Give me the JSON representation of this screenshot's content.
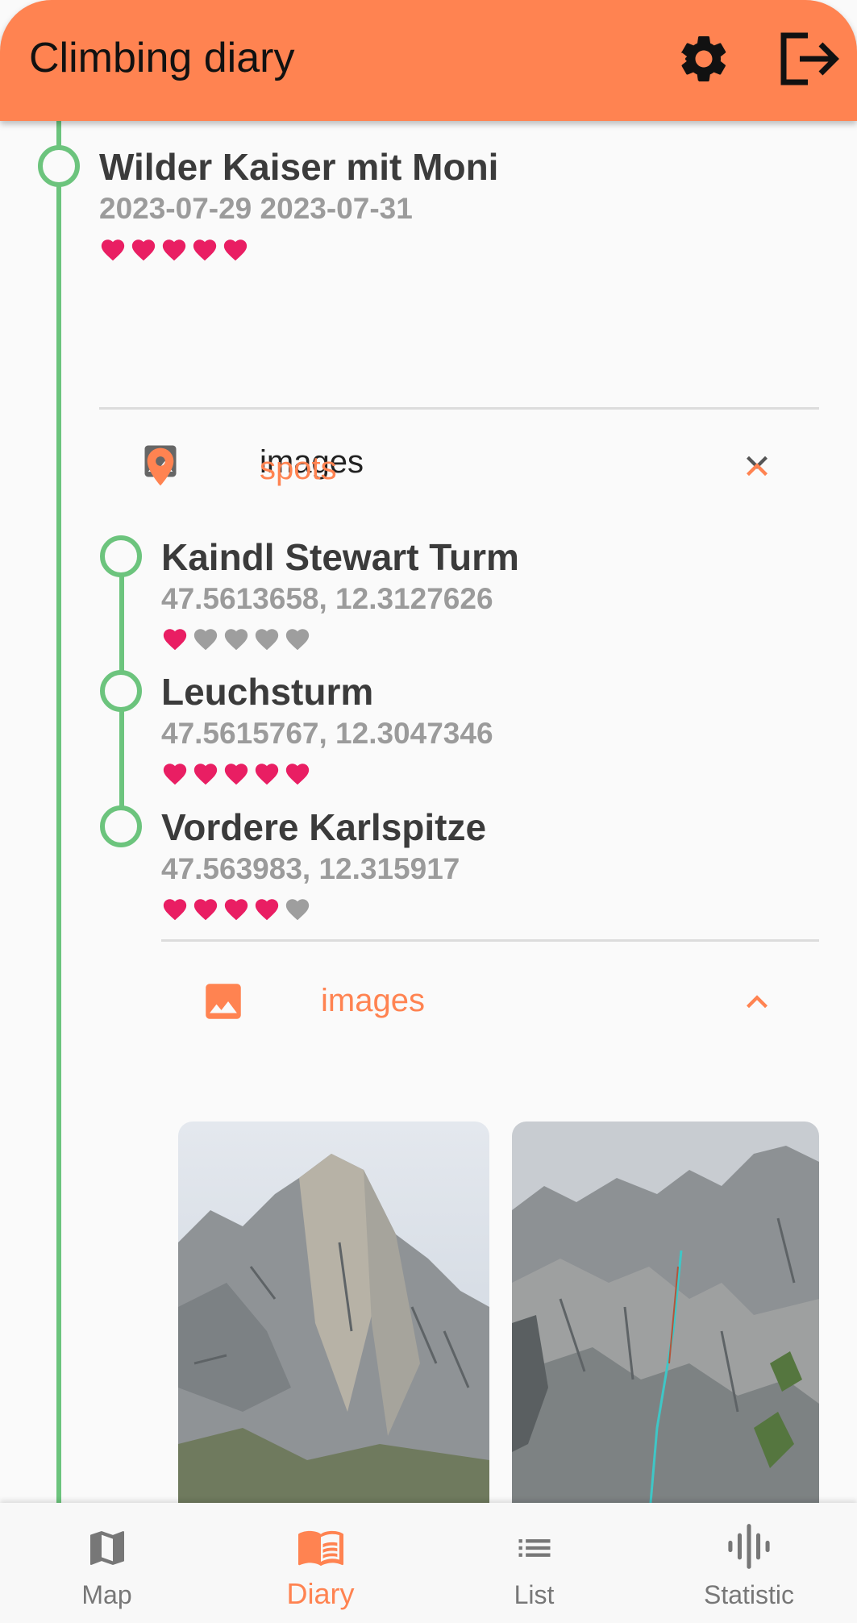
{
  "app_bar": {
    "title": "Climbing diary"
  },
  "trip": {
    "title": "Wilder Kaiser mit Moni",
    "dates": "2023-07-29 2023-07-31",
    "rating": 5
  },
  "sections": {
    "images_label": "images",
    "spots_label": "spots"
  },
  "spots": [
    {
      "name": "Kaindl Stewart Turm",
      "coords": "47.5613658, 12.3127626",
      "rating": 1
    },
    {
      "name": "Leuchsturm",
      "coords": "47.5615767, 12.3047346",
      "rating": 5
    },
    {
      "name": "Vordere Karlspitze",
      "coords": "47.563983, 12.315917",
      "rating": 4
    }
  ],
  "spot_images_label": "images",
  "colors": {
    "accent": "#ff8351",
    "timeline": "#6cc47d",
    "heart_on": "#e91e63",
    "heart_off": "#9e9e9e"
  },
  "bottom_nav": {
    "items": [
      {
        "label": "Map",
        "icon": "map-icon"
      },
      {
        "label": "Diary",
        "icon": "book-icon",
        "active": true
      },
      {
        "label": "List",
        "icon": "list-icon"
      },
      {
        "label": "Statistic",
        "icon": "statistic-icon"
      }
    ]
  }
}
